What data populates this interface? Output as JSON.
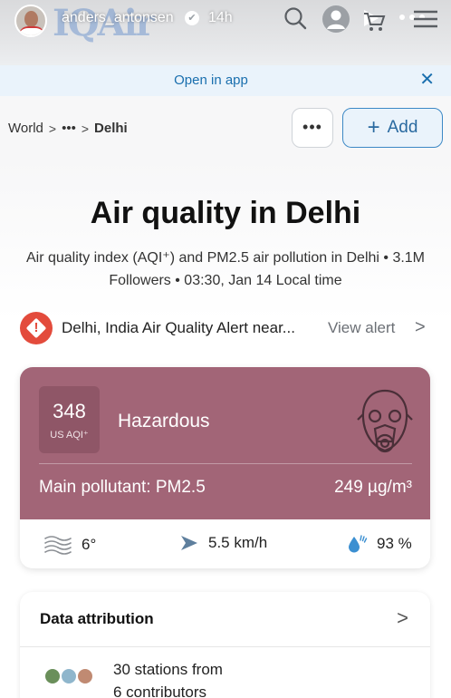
{
  "story": {
    "username": "anders_antonsen",
    "time": "14h",
    "background_logo": "IQAir",
    "icons": [
      "search-icon",
      "profile-icon",
      "play-icon",
      "cart-icon",
      "more-icon"
    ]
  },
  "banner": {
    "text": "Open in app",
    "close_icon": "close-icon"
  },
  "breadcrumb": {
    "items": [
      "World",
      "•••",
      "Delhi"
    ]
  },
  "actions": {
    "more_label": "•••",
    "add_label": "Add"
  },
  "header": {
    "title": "Air quality in Delhi",
    "subtitle": "Air quality index (AQI⁺) and PM2.5 air pollution in Delhi • 3.1M Followers • 03:30, Jan 14 Local time"
  },
  "alert": {
    "text": "Delhi, India Air Quality Alert near...",
    "link_label": "View alert"
  },
  "aqi": {
    "value": "348",
    "unit": "US AQI⁺",
    "level": "Hazardous",
    "pollutant": "Main pollutant: PM2.5",
    "concentration": "249 µg/m³",
    "card_color": "#a26577"
  },
  "weather": {
    "temperature": "6°",
    "wind": "5.5 km/h",
    "humidity": "93 %"
  },
  "attribution": {
    "title": "Data attribution",
    "stations_line1": "30 stations from",
    "stations_line2": "6 contributors"
  }
}
